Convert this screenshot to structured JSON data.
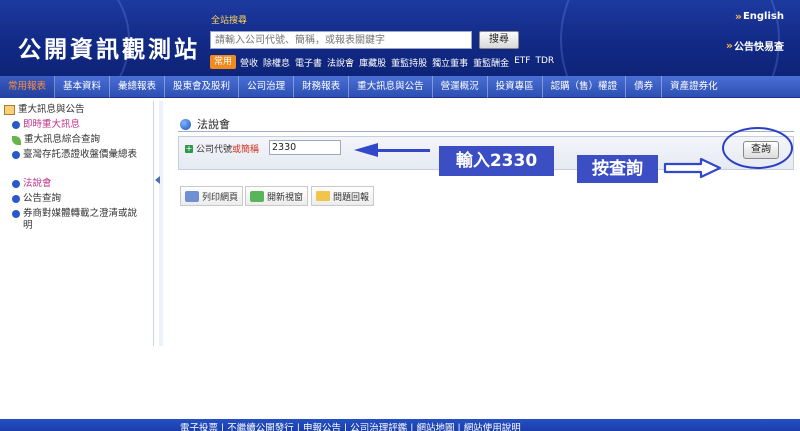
{
  "header": {
    "logo": "公開資訊觀測站",
    "search_label": "全站搜尋",
    "search_placeholder": "請輸入公司代號、簡稱，或報表關鍵字",
    "search_button": "搜尋",
    "common_badge": "常用",
    "quick_links": [
      "營收",
      "除權息",
      "電子書",
      "法說會",
      "庫藏股",
      "董監持股",
      "獨立董事",
      "董監酬金",
      "ETF",
      "TDR"
    ],
    "english_link": "English",
    "bulletin_link": "公告快易查"
  },
  "nav": {
    "items": [
      "常用報表",
      "基本資料",
      "彙總報表",
      "股東會及股利",
      "公司治理",
      "財務報表",
      "重大訊息與公告",
      "營運概況",
      "投資專區",
      "認購（售）權證",
      "債券",
      "資產證券化"
    ],
    "active_index": 0
  },
  "sidebar": {
    "root": "重大訊息與公告",
    "items": [
      "即時重大訊息",
      "重大訊息綜合查詢",
      "臺灣存託憑證收盤價彙總表",
      "法說會",
      "公告查詢",
      "券商對媒體轉載之澄清或說明"
    ]
  },
  "main": {
    "title": "法說會",
    "code_label_prefix": "公司代號",
    "code_label_red": "或簡稱",
    "code_value": "2330",
    "query_button": "查詢",
    "tools": [
      "列印網頁",
      "開新視窗",
      "問題回報"
    ]
  },
  "annotations": {
    "enter_text": "輸入2330",
    "press_text": "按查詢"
  },
  "footer": {
    "text": "電子投票 | 不繼續公開發行 | 申報公告 | 公司治理評鑑 | 網站地圖 | 網站使用說明"
  },
  "colors": {
    "header_blue": "#122a86",
    "nav_blue": "#2c4fb3",
    "accent_orange": "#f0891e",
    "annotation_blue": "#3b4ec4",
    "label_red": "#d2301f"
  }
}
